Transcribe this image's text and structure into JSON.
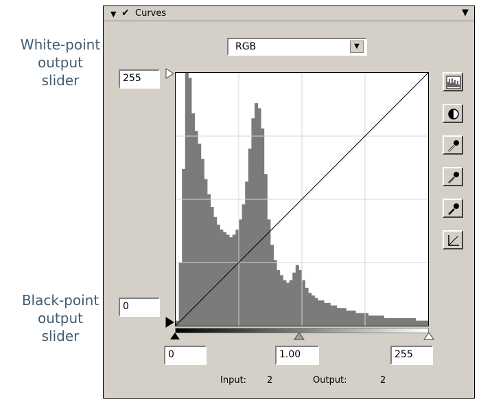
{
  "annotations": {
    "white_point": [
      "White-point",
      "output",
      "slider"
    ],
    "black_point": [
      "Black-point",
      "output",
      "slider"
    ],
    "leader_color": "#e2302a"
  },
  "panel": {
    "title": "Curves",
    "channel": "RGB",
    "output_max": "255",
    "output_min": "0",
    "input_black": "0",
    "gamma": "1.00",
    "input_white": "255",
    "input_label": "Input:",
    "input_value": "2",
    "output_label": "Output:",
    "output_value": "2"
  },
  "tools": [
    {
      "name": "histogram-icon"
    },
    {
      "name": "contrast-icon"
    },
    {
      "name": "white-eyedropper-icon"
    },
    {
      "name": "gray-eyedropper-icon"
    },
    {
      "name": "black-eyedropper-icon"
    },
    {
      "name": "reset-curve-icon"
    }
  ],
  "histogram": {
    "color": "#7b7b7b",
    "values": [
      0.02,
      0.25,
      0.62,
      1.0,
      0.98,
      0.84,
      0.77,
      0.72,
      0.66,
      0.58,
      0.52,
      0.47,
      0.43,
      0.4,
      0.38,
      0.37,
      0.36,
      0.35,
      0.36,
      0.38,
      0.42,
      0.48,
      0.57,
      0.7,
      0.82,
      0.88,
      0.86,
      0.78,
      0.6,
      0.42,
      0.32,
      0.26,
      0.22,
      0.2,
      0.18,
      0.17,
      0.18,
      0.21,
      0.24,
      0.22,
      0.18,
      0.15,
      0.13,
      0.12,
      0.11,
      0.1,
      0.1,
      0.09,
      0.09,
      0.08,
      0.08,
      0.07,
      0.07,
      0.07,
      0.06,
      0.06,
      0.06,
      0.05,
      0.05,
      0.05,
      0.05,
      0.04,
      0.04,
      0.04,
      0.04,
      0.04,
      0.03,
      0.03,
      0.03,
      0.03,
      0.03,
      0.03,
      0.03,
      0.03,
      0.03,
      0.03,
      0.02,
      0.02,
      0.02,
      0.02
    ]
  }
}
